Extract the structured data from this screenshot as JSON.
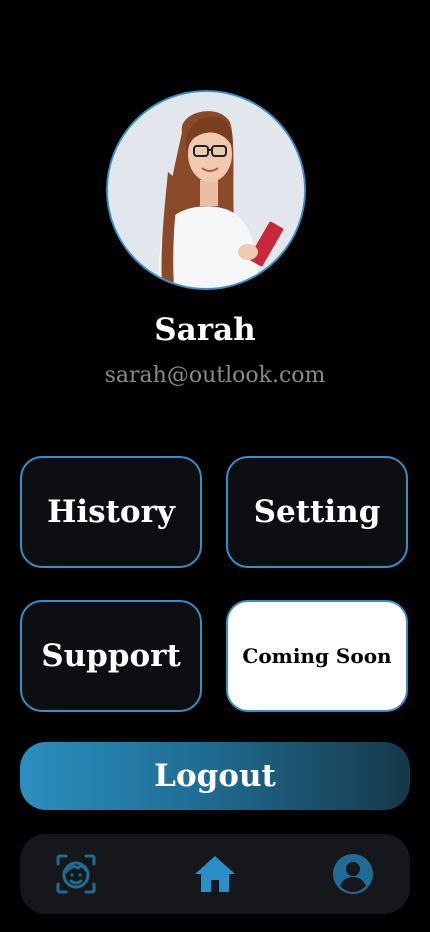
{
  "profile": {
    "name": "Sarah",
    "email": "sarah@outlook.com"
  },
  "tiles": {
    "history": "History",
    "setting": "Setting",
    "support": "Support",
    "coming_soon": "Coming Soon"
  },
  "logout_label": "Logout",
  "bottom_nav": {
    "items": [
      {
        "icon": "face-scan-icon",
        "active": false
      },
      {
        "icon": "home-icon",
        "active": true
      },
      {
        "icon": "profile-icon",
        "active": false
      }
    ]
  },
  "colors": {
    "background": "#000000",
    "accent": "#3a8fc2",
    "tile_bg": "#0c0e12",
    "nav_bg": "#15171a",
    "nav_icon": "#1f6d94",
    "nav_icon_active": "#2b8fc7",
    "email_text": "#8a8a8a"
  }
}
